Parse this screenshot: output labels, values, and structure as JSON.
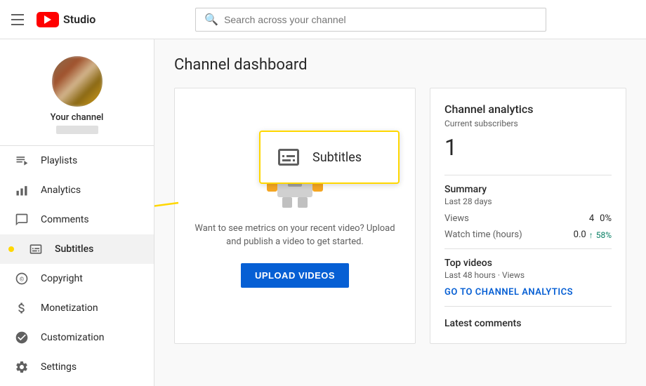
{
  "header": {
    "hamburger_label": "Menu",
    "logo_text": "Studio",
    "search_placeholder": "Search across your channel"
  },
  "sidebar": {
    "channel_name": "Your channel",
    "nav_items": [
      {
        "id": "playlists",
        "label": "Playlists",
        "icon": "≡"
      },
      {
        "id": "analytics",
        "label": "Analytics",
        "icon": "📊"
      },
      {
        "id": "comments",
        "label": "Comments",
        "icon": "💬"
      },
      {
        "id": "subtitles",
        "label": "Subtitles",
        "icon": "⊟",
        "active": true
      },
      {
        "id": "copyright",
        "label": "Copyright",
        "icon": "©"
      },
      {
        "id": "monetization",
        "label": "Monetization",
        "icon": "$"
      },
      {
        "id": "customization",
        "label": "Customization",
        "icon": "✦"
      },
      {
        "id": "settings",
        "label": "Settings",
        "icon": "⚙"
      }
    ]
  },
  "main": {
    "page_title": "Channel dashboard",
    "video_section": {
      "empty_message": "Want to see metrics on your recent video? Upload and publish a video to get started.",
      "upload_button": "UPLOAD VIDEOS"
    },
    "analytics": {
      "title": "Channel analytics",
      "subscribers_label": "Current subscribers",
      "subscribers_count": "1",
      "summary_title": "Summary",
      "summary_period": "Last 28 days",
      "views_label": "Views",
      "views_value": "4",
      "views_suffix": "0%",
      "watch_time_label": "Watch time (hours)",
      "watch_time_value": "0.0",
      "watch_time_arrow": "↑",
      "watch_time_pct": "58%",
      "top_videos_title": "Top videos",
      "top_videos_sub": "Last 48 hours · Views",
      "channel_analytics_link": "GO TO CHANNEL ANALYTICS",
      "latest_comments_title": "Latest comments"
    },
    "tooltip": {
      "label": "Subtitles"
    }
  }
}
